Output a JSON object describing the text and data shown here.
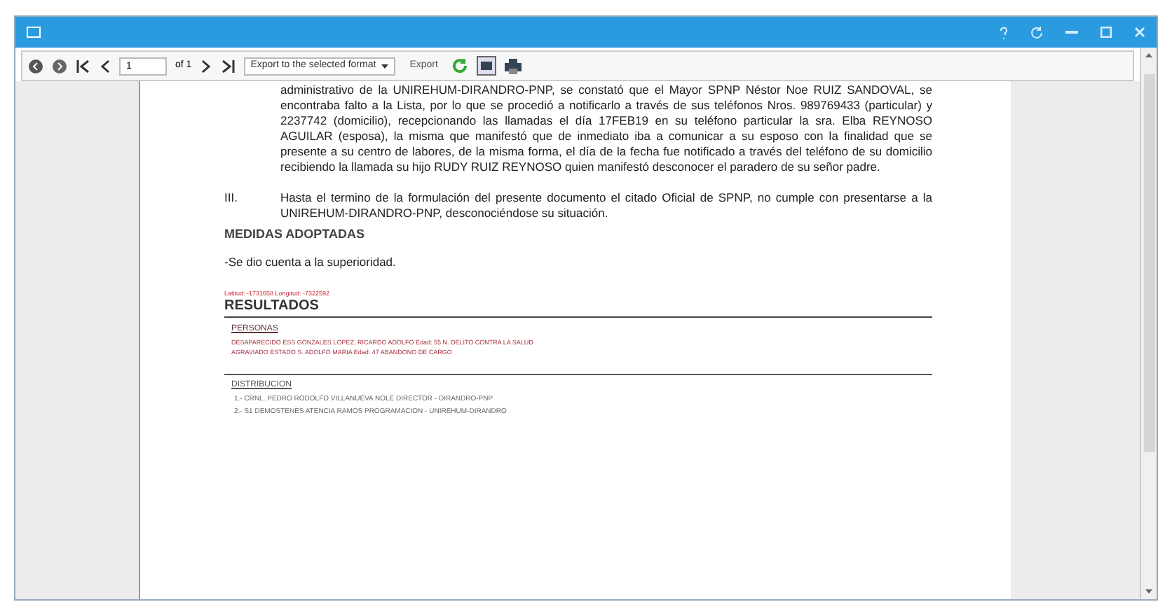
{
  "toolbar": {
    "page_value": "1",
    "page_count": "of 1",
    "format_select": "Export to the selected format",
    "export_button": "Export"
  },
  "document": {
    "paragraph": "administrativo de la UNIREHUM-DIRANDRO-PNP, se constató que el Mayor SPNP Néstor Noe RUIZ SANDOVAL, se encontraba falto a la Lista, por lo que se procedió a notificarlo a través de sus teléfonos Nros. 989769433 (particular) y 2237742 (domicilio), recepcionando las llamadas el día 17FEB19 en su teléfono particular la sra. Elba REYNOSO AGUILAR (esposa), la misma que manifestó que de inmediato iba a comunicar a su esposo con la finalidad que se presente a su centro de labores, de la misma forma, el día de la fecha fue notificado a través del teléfono de su domicilio recibiendo la llamada su hijo RUDY RUIZ REYNOSO quien manifestó desconocer el paradero de su señor padre.",
    "item_number": "III.",
    "item_text": "Hasta el termino de la formulación del presente documento el citado Oficial de SPNP, no cumple con presentarse a la UNIREHUM-DIRANDRO-PNP, desconociéndose su situación.",
    "measures_heading": "MEDIDAS ADOPTADAS",
    "measures_text": "-Se dio cuenta a la superioridad.",
    "coordinates": "Latitud: -1731658 Longitud: -7322592",
    "results_heading": "RESULTADOS",
    "persons_heading": "PERSONAS",
    "persons": [
      "DESAPARECIDO ESS GONZALES LOPEZ, RICARDO ADOLFO Edad: 55 N. DELITO CONTRA LA SALUD",
      "AGRAVIADO ESTADO S. ADOLFO MARIA Edad: 47 ABANDONO DE CARGO"
    ],
    "distribution_heading": "DISTRIBUCION",
    "distribution": [
      "1.- CRNL. PEDRO RODOLFO VILLANUEVA NOLE DIRECTOR - DIRANDRO-PNP",
      "2.- S1 DEMOSTENES ATENCIA RAMOS PROGRAMACION - UNIREHUM-DIRANDRO"
    ]
  }
}
